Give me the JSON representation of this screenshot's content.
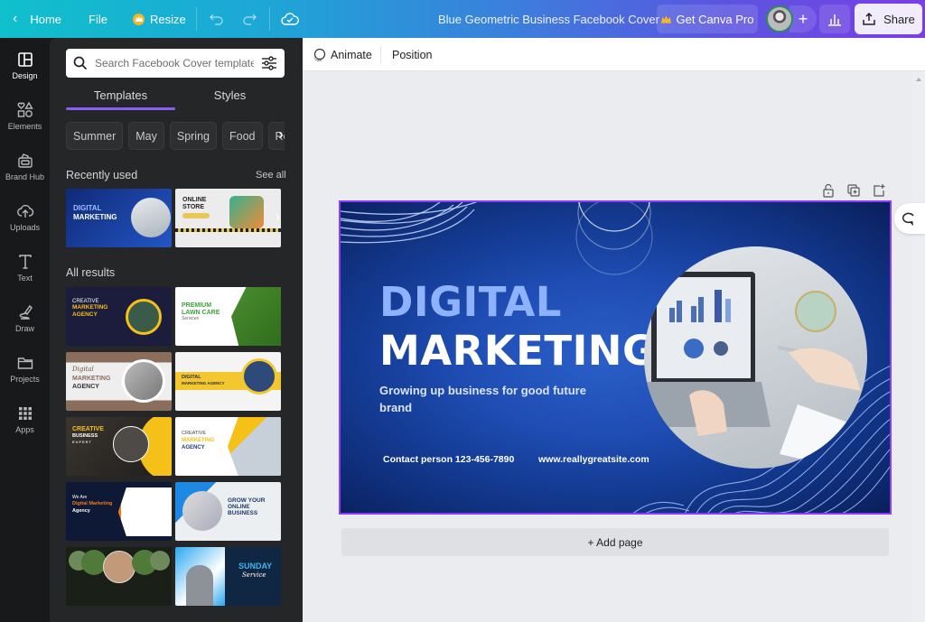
{
  "topbar": {
    "home_label": "Home",
    "file_label": "File",
    "resize_label": "Resize",
    "document_title": "Blue Geometric Business Facebook Cover",
    "get_pro_label": "Get Canva Pro",
    "add_label": "+",
    "share_label": "Share",
    "colors": {
      "gradient_start": "#10c0cc",
      "gradient_end": "#7a3ee6",
      "crown": "#f5b728"
    }
  },
  "rail": {
    "items": [
      {
        "label": "Design",
        "icon": "layout-icon",
        "active": true
      },
      {
        "label": "Elements",
        "icon": "shapes-icon"
      },
      {
        "label": "Brand Hub",
        "icon": "brand-hub-icon"
      },
      {
        "label": "Uploads",
        "icon": "cloud-upload-icon"
      },
      {
        "label": "Text",
        "icon": "text-icon"
      },
      {
        "label": "Draw",
        "icon": "draw-icon"
      },
      {
        "label": "Projects",
        "icon": "folder-icon"
      },
      {
        "label": "Apps",
        "icon": "apps-grid-icon"
      }
    ]
  },
  "panel": {
    "search_placeholder": "Search Facebook Cover templates",
    "tabs": [
      {
        "label": "Templates",
        "active": true
      },
      {
        "label": "Styles"
      }
    ],
    "chips": [
      "Summer",
      "May",
      "Spring",
      "Food",
      "Real e"
    ],
    "recently_used_label": "Recently used",
    "see_all_label": "See all",
    "recent": [
      {
        "title1": "DIGITAL",
        "title2": "MARKETING"
      },
      {
        "title1": "ONLINE",
        "title2": "STORE"
      }
    ],
    "all_results_label": "All results",
    "results": [
      {
        "line1": "CREATIVE",
        "line2": "MARKETING",
        "line3": "AGENCY"
      },
      {
        "line1": "PREMIUM",
        "line2": "LAWN CARE",
        "line3": "Services"
      },
      {
        "line1": "Digital",
        "line2": "MARKETING",
        "line3": "AGENCY"
      },
      {
        "line1": "DIGITAL",
        "line2": "MARKETING AGENCY",
        "line3": ""
      },
      {
        "line1": "CREATIVE",
        "line2": "BUSINESS",
        "line3": "EXPERT"
      },
      {
        "line1": "CREATIVE",
        "line2": "MARKETING",
        "line3": "AGENCY"
      },
      {
        "line1": "We Are",
        "line2": "Digital Marketing",
        "line3": "Agency"
      },
      {
        "line1": "GROW YOUR",
        "line2": "ONLINE",
        "line3": "BUSINESS"
      },
      {
        "line1": "",
        "line2": "",
        "line3": ""
      },
      {
        "line1": "SUNDAY",
        "line2": "Service",
        "line3": ""
      }
    ]
  },
  "context_bar": {
    "animate_label": "Animate",
    "position_label": "Position"
  },
  "design": {
    "title_line1": "DIGITAL",
    "title_line2": "MARKETING",
    "subtitle": "Growing up business for good future brand",
    "contact": "Contact person 123-456-7890",
    "website": "www.reallygreatsite.com",
    "colors": {
      "title1": "#8eb2ff",
      "background": "#1f4db4",
      "selection": "#8b3dff"
    }
  },
  "add_page_label": "+ Add page"
}
